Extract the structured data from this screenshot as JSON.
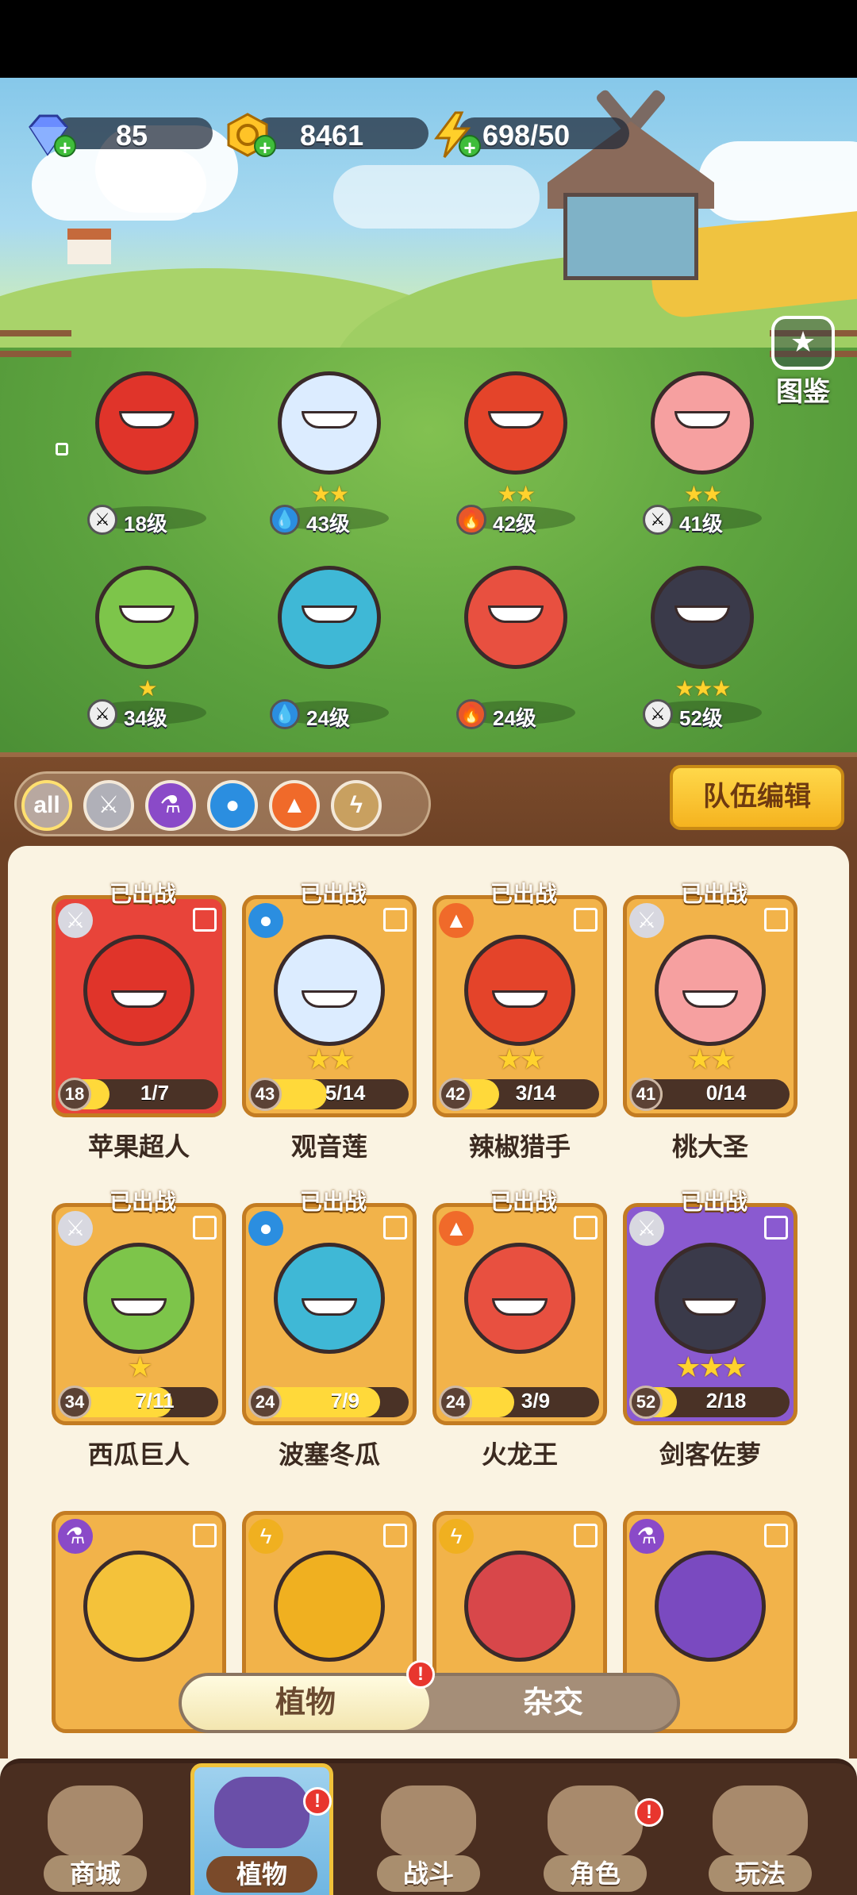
{
  "resources": {
    "gems": "85",
    "coins": "8461",
    "energy": "698/50"
  },
  "codex_label": "图鉴",
  "heroes": [
    {
      "level": "18级",
      "stars": "",
      "element": "sword",
      "color": "#e0342a"
    },
    {
      "level": "43级",
      "stars": "★★",
      "element": "water",
      "color": "#dcecff"
    },
    {
      "level": "42级",
      "stars": "★★",
      "element": "fire",
      "color": "#e4442a"
    },
    {
      "level": "41级",
      "stars": "★★",
      "element": "sword",
      "color": "#f6a0a0"
    },
    {
      "level": "34级",
      "stars": "★",
      "element": "sword",
      "color": "#7dc54a"
    },
    {
      "level": "24级",
      "stars": "",
      "element": "water",
      "color": "#3fb8d6"
    },
    {
      "level": "24级",
      "stars": "",
      "element": "fire",
      "color": "#e85040"
    },
    {
      "level": "52级",
      "stars": "★★★",
      "element": "sword",
      "color": "#3a3a4a"
    }
  ],
  "filters": {
    "all_label": "all",
    "team_edit": "队伍编辑"
  },
  "deployed_label": "已出战",
  "cards": [
    {
      "name": "苹果超人",
      "level": "18",
      "progress": "1/7",
      "fill": 0.143,
      "stars": "",
      "element": "sword",
      "bg": "#e8443a",
      "color": "#e0342a"
    },
    {
      "name": "观音莲",
      "level": "43",
      "progress": "5/14",
      "fill": 0.357,
      "stars": "★★",
      "element": "water",
      "bg": "#f2b34a",
      "color": "#dcecff"
    },
    {
      "name": "辣椒猎手",
      "level": "42",
      "progress": "3/14",
      "fill": 0.214,
      "stars": "★★",
      "element": "fire",
      "bg": "#f2b34a",
      "color": "#e4442a"
    },
    {
      "name": "桃大圣",
      "level": "41",
      "progress": "0/14",
      "fill": 0.0,
      "stars": "★★",
      "element": "sword",
      "bg": "#f2b34a",
      "color": "#f6a0a0"
    },
    {
      "name": "西瓜巨人",
      "level": "34",
      "progress": "7/11",
      "fill": 0.636,
      "stars": "★",
      "element": "sword",
      "bg": "#f2b34a",
      "color": "#7dc54a"
    },
    {
      "name": "波塞冬瓜",
      "level": "24",
      "progress": "7/9",
      "fill": 0.778,
      "stars": "",
      "element": "water",
      "bg": "#f2b34a",
      "color": "#3fb8d6"
    },
    {
      "name": "火龙王",
      "level": "24",
      "progress": "3/9",
      "fill": 0.333,
      "stars": "",
      "element": "fire",
      "bg": "#f2b34a",
      "color": "#e85040"
    },
    {
      "name": "剑客佐萝",
      "level": "52",
      "progress": "2/18",
      "fill": 0.111,
      "stars": "★★★",
      "element": "sword",
      "bg": "#8a5ad0",
      "color": "#3a3a4a"
    }
  ],
  "partial_cards": [
    {
      "element": "potion",
      "color": "#f4c23a"
    },
    {
      "element": "lightning",
      "color": "#f0b020"
    },
    {
      "element": "lightning",
      "color": "#d8474a"
    },
    {
      "element": "potion",
      "color": "#7a4ac0"
    }
  ],
  "toggle": {
    "active": "植物",
    "inactive": "杂交"
  },
  "nav": {
    "shop": "商城",
    "plants": "植物",
    "battle": "战斗",
    "character": "角色",
    "gameplay": "玩法"
  }
}
